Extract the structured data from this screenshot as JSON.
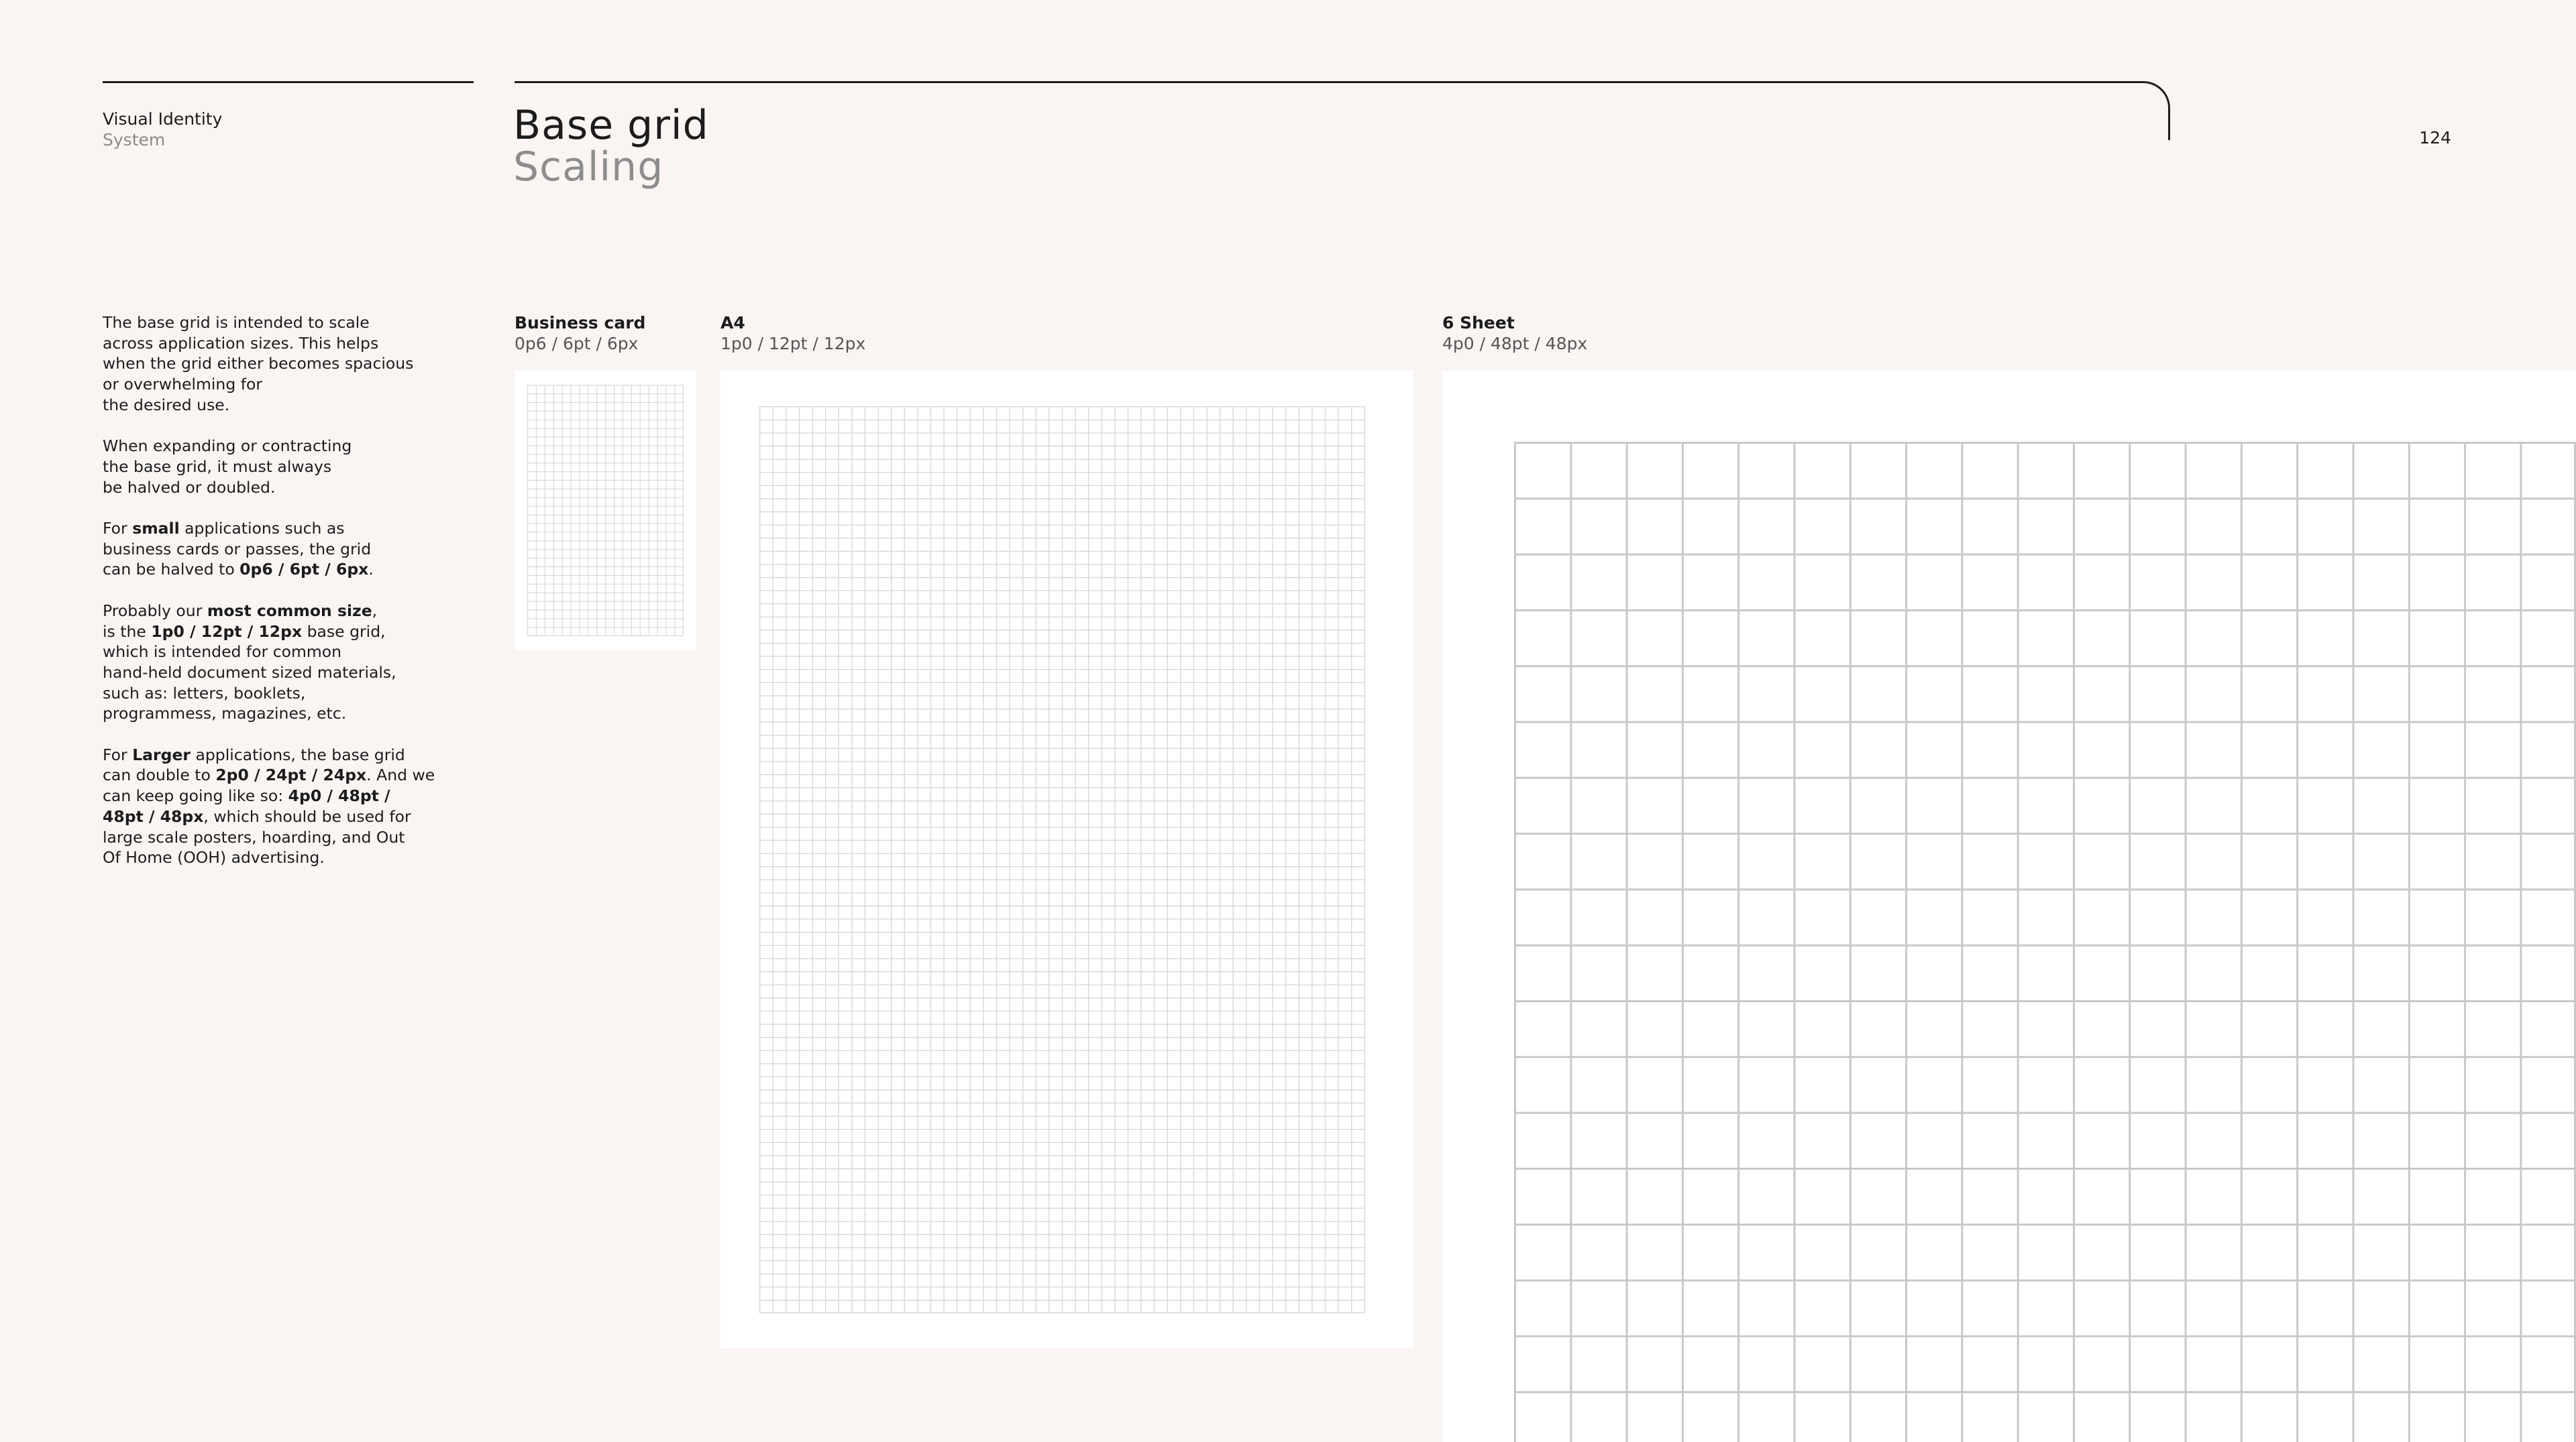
{
  "header": {
    "section": "Visual Identity",
    "subsection": "System",
    "title": "Base grid",
    "subtitle": "Scaling",
    "page_number": "124"
  },
  "body": [
    [
      {
        "t": "The base grid is intended to scale\nacross application sizes. This helps\nwhen the grid either becomes spacious\nor overwhelming for\nthe desired use."
      }
    ],
    [
      {
        "t": "When expanding or contracting\nthe base grid, it must always\nbe halved or doubled."
      }
    ],
    [
      {
        "t": "For "
      },
      {
        "t": "small",
        "b": true
      },
      {
        "t": " applications such as\nbusiness cards or passes, the grid\ncan be halved to "
      },
      {
        "t": "0p6 / 6pt / 6px",
        "b": true
      },
      {
        "t": "."
      }
    ],
    [
      {
        "t": "Probably our "
      },
      {
        "t": "most common size",
        "b": true
      },
      {
        "t": ",\nis the "
      },
      {
        "t": "1p0 / 12pt / 12px",
        "b": true
      },
      {
        "t": " base grid,\nwhich is intended for common\nhand-held document sized materials,\nsuch as: letters, booklets,\nprogrammess, magazines, etc."
      }
    ],
    [
      {
        "t": "For "
      },
      {
        "t": "Larger",
        "b": true
      },
      {
        "t": " applications, the base grid\ncan double to "
      },
      {
        "t": "2p0 / 24pt / 24px",
        "b": true
      },
      {
        "t": ". And we\ncan keep going like so: "
      },
      {
        "t": "4p0 / 48pt /\n48pt / 48px",
        "b": true
      },
      {
        "t": ", which should be used for\nlarge scale posters, hoarding, and Out\nOf Home (OOH) advertising."
      }
    ]
  ],
  "examples": [
    {
      "title": "Business card",
      "spec": "0p6 / 6pt / 6px"
    },
    {
      "title": "A4",
      "spec": "1p0 / 12pt / 12px"
    },
    {
      "title": "6 Sheet",
      "spec": "4p0 / 48pt / 48px"
    }
  ],
  "colors": {
    "background": "#faf5f3",
    "sheet": "#ffffff",
    "grid_line": "#c8c8c8",
    "text": "#1c1c1c",
    "muted": "#8d8d8d"
  }
}
